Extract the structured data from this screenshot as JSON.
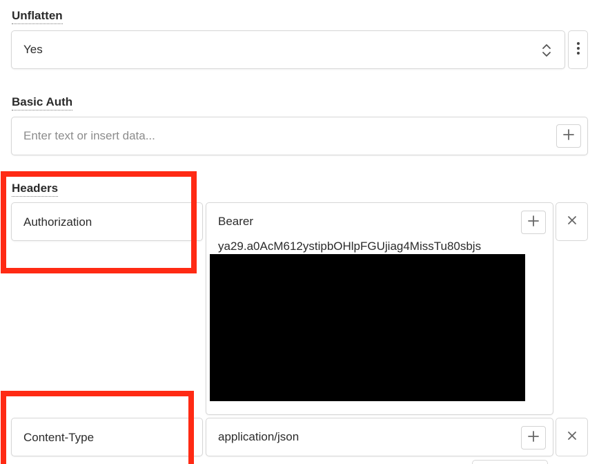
{
  "unflatten": {
    "label": "Unflatten",
    "value": "Yes",
    "icon_select": "chevron-up-down-icon",
    "icon_menu": "vertical-ellipsis-icon"
  },
  "basic_auth": {
    "label": "Basic Auth",
    "placeholder": "Enter text or insert data...",
    "icon_add": "plus-icon"
  },
  "headers": {
    "label": "Headers",
    "rows": [
      {
        "key": "Authorization",
        "value_line1": "Bearer",
        "value_line2": "ya29.a0AcM612ystipbOHlpFGUjiag4MissTu80sbjs"
      },
      {
        "key": "Content-Type",
        "value_line1": "application/json"
      }
    ],
    "icon_add": "plus-icon",
    "icon_remove": "close-icon"
  },
  "colors": {
    "highlight": "#ff2a14",
    "redaction": "#000000",
    "border": "#d6d6d6",
    "placeholder": "#8c8c8c"
  }
}
